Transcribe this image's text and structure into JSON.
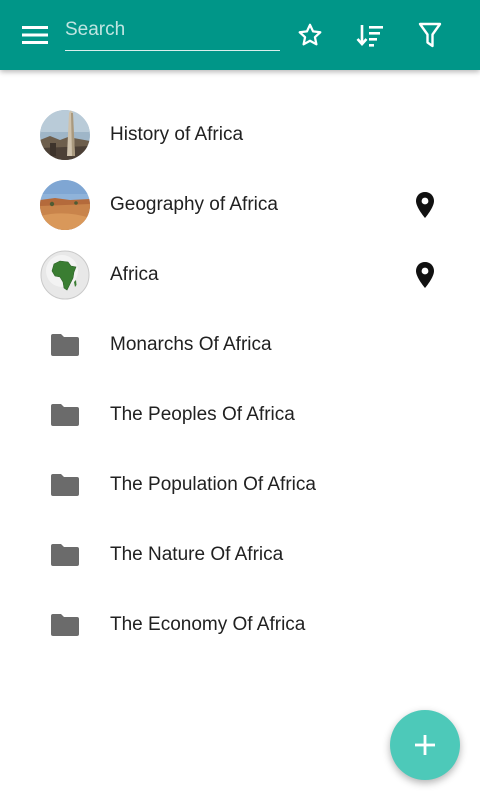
{
  "header": {
    "search_placeholder": "Search",
    "search_value": "",
    "background_color": "#009688",
    "icons": [
      "menu-icon",
      "star-outline-icon",
      "sort-icon",
      "filter-icon"
    ]
  },
  "list": {
    "items": [
      {
        "label": "History of Africa",
        "type": "article",
        "icon": "thumbnail-obelisk",
        "location_pin": false
      },
      {
        "label": "Geography of Africa",
        "type": "article",
        "icon": "thumbnail-desert",
        "location_pin": true
      },
      {
        "label": "Africa",
        "type": "article",
        "icon": "thumbnail-globe",
        "location_pin": true
      },
      {
        "label": "Monarchs Of Africa",
        "type": "folder",
        "icon": "folder-icon",
        "location_pin": false
      },
      {
        "label": "The Peoples Of Africa",
        "type": "folder",
        "icon": "folder-icon",
        "location_pin": false
      },
      {
        "label": "The Population Of Africa",
        "type": "folder",
        "icon": "folder-icon",
        "location_pin": false
      },
      {
        "label": "The Nature Of Africa",
        "type": "folder",
        "icon": "folder-icon",
        "location_pin": false
      },
      {
        "label": "The Economy Of Africa",
        "type": "folder",
        "icon": "folder-icon",
        "location_pin": false
      }
    ]
  },
  "fab": {
    "icon": "plus-icon",
    "color": "#4DC9B9"
  }
}
